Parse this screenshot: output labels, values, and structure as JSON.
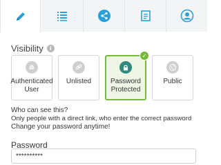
{
  "tabs": [
    {
      "icon": "pencil-icon",
      "active": true
    },
    {
      "icon": "list-icon",
      "active": false
    },
    {
      "icon": "share-icon",
      "active": false
    },
    {
      "icon": "document-icon",
      "active": false
    },
    {
      "icon": "user-icon",
      "active": false
    }
  ],
  "visibility": {
    "label": "Visibility",
    "info_glyph": "i",
    "options": [
      {
        "label_line1": "Authenticated",
        "label_line2": "User",
        "icon": "fingerprint-icon",
        "selected": false
      },
      {
        "label_line1": "Unlisted",
        "label_line2": "",
        "icon": "link-icon",
        "selected": false
      },
      {
        "label_line1": "Password",
        "label_line2": "Protected",
        "icon": "lock-icon",
        "selected": true
      },
      {
        "label_line1": "Public",
        "label_line2": "",
        "icon": "globe-icon",
        "selected": false
      }
    ],
    "selected_check": "✓"
  },
  "helper": {
    "line1": "Who can see this?",
    "line2": "Only people with a direct link, who enter the correct password",
    "line3": "Change your password anytime!"
  },
  "password": {
    "label": "Password",
    "value": "**********"
  },
  "colors": {
    "accent": "#2a9fd8",
    "selected_border": "#77b83a",
    "selected_icon": "#2f8a7d"
  }
}
